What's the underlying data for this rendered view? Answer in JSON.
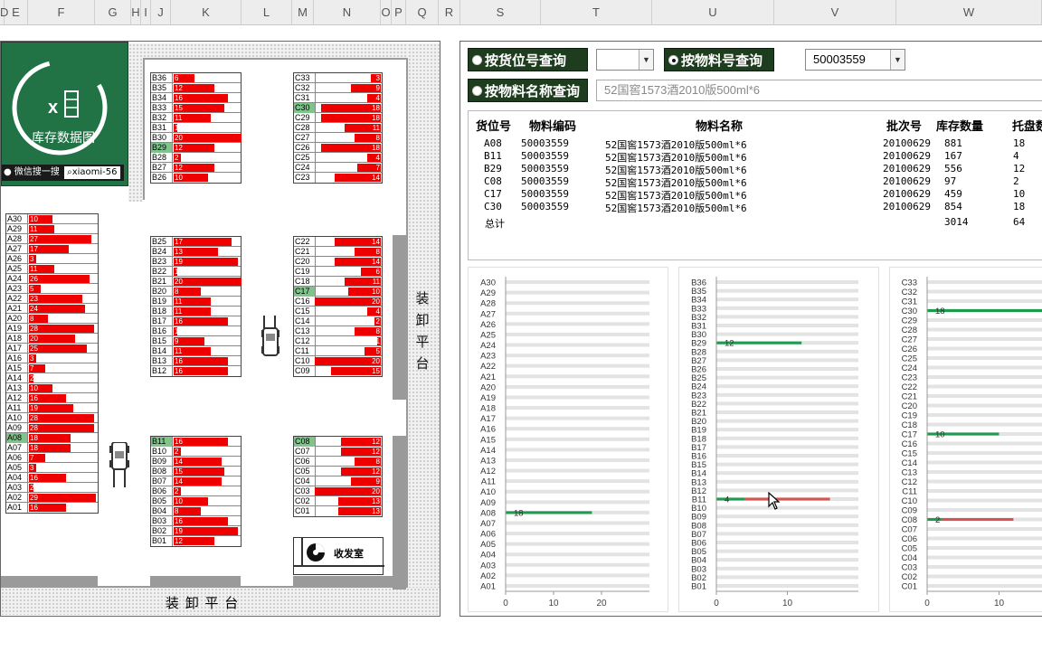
{
  "columns": [
    "D",
    "E",
    "F",
    "G",
    "H",
    "I",
    "J",
    "K",
    "L",
    "M",
    "N",
    "O",
    "P",
    "Q",
    "R",
    "S",
    "T",
    "U",
    "V",
    "W"
  ],
  "logo": {
    "title": "库存数据图",
    "search_text": "微信搜一搜",
    "search_id": "xiaomi-56"
  },
  "map": {
    "dock_right": "装卸平台",
    "dock_bottom": "装 卸 平 台",
    "mail_room": "收发室"
  },
  "racks": {
    "B_top": [
      [
        "B36",
        "6"
      ],
      [
        "B35",
        "12"
      ],
      [
        "B34",
        "16"
      ],
      [
        "B33",
        "15"
      ],
      [
        "B32",
        "11"
      ],
      [
        "B31",
        "1"
      ],
      [
        "B30",
        "20"
      ],
      [
        "B29",
        "12"
      ],
      [
        "B28",
        "2"
      ],
      [
        "B27",
        "12"
      ],
      [
        "B26",
        "10"
      ]
    ],
    "C_top": [
      [
        "C33",
        "3"
      ],
      [
        "C32",
        "9"
      ],
      [
        "C31",
        "4"
      ],
      [
        "C30",
        "18"
      ],
      [
        "C29",
        "18"
      ],
      [
        "C28",
        "11"
      ],
      [
        "C27",
        "8"
      ],
      [
        "C26",
        "18"
      ],
      [
        "C25",
        "4"
      ],
      [
        "C24",
        "7"
      ],
      [
        "C23",
        "14"
      ]
    ],
    "A": [
      [
        "A30",
        "10"
      ],
      [
        "A29",
        "11"
      ],
      [
        "A28",
        "27"
      ],
      [
        "A27",
        "17"
      ],
      [
        "A26",
        "3"
      ],
      [
        "A25",
        "11"
      ],
      [
        "A24",
        "26"
      ],
      [
        "A23",
        "5"
      ],
      [
        "A22",
        "23"
      ],
      [
        "A21",
        "24"
      ],
      [
        "A20",
        "8"
      ],
      [
        "A19",
        "28"
      ],
      [
        "A18",
        "20"
      ],
      [
        "A17",
        "25"
      ],
      [
        "A16",
        "3"
      ],
      [
        "A15",
        "7"
      ],
      [
        "A14",
        "2"
      ],
      [
        "A13",
        "10"
      ],
      [
        "A12",
        "16"
      ],
      [
        "A11",
        "19"
      ],
      [
        "A10",
        "28"
      ],
      [
        "A09",
        "28"
      ],
      [
        "A08",
        "18"
      ],
      [
        "A07",
        "18"
      ],
      [
        "A06",
        "7"
      ],
      [
        "A05",
        "3"
      ],
      [
        "A04",
        "16"
      ],
      [
        "A03",
        "2"
      ],
      [
        "A02",
        "29"
      ],
      [
        "A01",
        "16"
      ]
    ],
    "B_mid": [
      [
        "B25",
        "17"
      ],
      [
        "B24",
        "13"
      ],
      [
        "B23",
        "19"
      ],
      [
        "B22",
        "1"
      ],
      [
        "B21",
        "20"
      ],
      [
        "B20",
        "8"
      ],
      [
        "B19",
        "11"
      ],
      [
        "B18",
        "11"
      ],
      [
        "B17",
        "16"
      ],
      [
        "B16",
        "1"
      ],
      [
        "B15",
        "9"
      ],
      [
        "B14",
        "11"
      ],
      [
        "B13",
        "16"
      ],
      [
        "B12",
        "16"
      ]
    ],
    "C_mid": [
      [
        "C22",
        "14"
      ],
      [
        "C21",
        "8"
      ],
      [
        "C20",
        "14"
      ],
      [
        "C19",
        "6"
      ],
      [
        "C18",
        "11"
      ],
      [
        "C17",
        "10"
      ],
      [
        "C16",
        "20"
      ],
      [
        "C15",
        "4"
      ],
      [
        "C14",
        "2"
      ],
      [
        "C13",
        "8"
      ],
      [
        "C12",
        "1"
      ],
      [
        "C11",
        "5"
      ],
      [
        "C10",
        "20"
      ],
      [
        "C09",
        "15"
      ]
    ],
    "B_bot": [
      [
        "B11",
        "16"
      ],
      [
        "B10",
        "2"
      ],
      [
        "B09",
        "14"
      ],
      [
        "B08",
        "15"
      ],
      [
        "B07",
        "14"
      ],
      [
        "B06",
        "2"
      ],
      [
        "B05",
        "10"
      ],
      [
        "B04",
        "8"
      ],
      [
        "B03",
        "16"
      ],
      [
        "B02",
        "19"
      ],
      [
        "B01",
        "12"
      ]
    ],
    "C_bot": [
      [
        "C08",
        "12"
      ],
      [
        "C07",
        "12"
      ],
      [
        "C06",
        "8"
      ],
      [
        "C05",
        "12"
      ],
      [
        "C04",
        "9"
      ],
      [
        "C03",
        "20"
      ],
      [
        "C02",
        "13"
      ],
      [
        "C01",
        "13"
      ]
    ]
  },
  "highlight": [
    "A08",
    "B11",
    "B29",
    "C08",
    "C17",
    "C30"
  ],
  "query": {
    "by_location": "按货位号查询",
    "by_code": "按物料号查询",
    "by_name": "按物料名称查询",
    "code_value": "50003559",
    "name_value": "52国窖1573酒2010版500ml*6",
    "location_value": ""
  },
  "table": {
    "headers": [
      "货位号",
      "物料编码",
      "物料名称",
      "批次号",
      "库存数量",
      "托盘数"
    ],
    "rows": [
      [
        "A08",
        "50003559",
        "52国窖1573酒2010版500ml*6",
        "20100629",
        "881",
        "18"
      ],
      [
        "B11",
        "50003559",
        "52国窖1573酒2010版500ml*6",
        "20100629",
        "167",
        "4"
      ],
      [
        "B29",
        "50003559",
        "52国窖1573酒2010版500ml*6",
        "20100629",
        "556",
        "12"
      ],
      [
        "C08",
        "50003559",
        "52国窖1573酒2010版500ml*6",
        "20100629",
        "97",
        "2"
      ],
      [
        "C17",
        "50003559",
        "52国窖1573酒2010版500ml*6",
        "20100629",
        "459",
        "10"
      ],
      [
        "C30",
        "50003559",
        "52国窖1573酒2010版500ml*6",
        "20100629",
        "854",
        "18"
      ]
    ],
    "total_label": "总计",
    "total_qty": "3014",
    "total_pallets": "64"
  },
  "colors": {
    "accent_green": "#1e9c4e",
    "bar_red": "#ee0000",
    "excel_green": "#217346"
  },
  "chart_data": [
    {
      "type": "bar",
      "orientation": "horizontal",
      "group": "A",
      "categories": [
        "A30",
        "A29",
        "A28",
        "A27",
        "A26",
        "A25",
        "A24",
        "A23",
        "A22",
        "A21",
        "A20",
        "A19",
        "A18",
        "A17",
        "A16",
        "A15",
        "A14",
        "A13",
        "A12",
        "A11",
        "A10",
        "A09",
        "A08",
        "A07",
        "A06",
        "A05",
        "A04",
        "A03",
        "A02",
        "A01"
      ],
      "values": [
        {
          "cat": "A08",
          "value": 18,
          "label": "18"
        }
      ],
      "xlim": [
        0,
        30
      ],
      "xticks": [
        0,
        10,
        20,
        30
      ],
      "grid": false
    },
    {
      "type": "bar",
      "orientation": "horizontal",
      "group": "B",
      "categories": [
        "B36",
        "B35",
        "B34",
        "B33",
        "B32",
        "B31",
        "B30",
        "B29",
        "B28",
        "B27",
        "B26",
        "B25",
        "B24",
        "B23",
        "B22",
        "B21",
        "B20",
        "B19",
        "B18",
        "B17",
        "B16",
        "B15",
        "B14",
        "B13",
        "B12",
        "B11",
        "B10",
        "B09",
        "B08",
        "B07",
        "B06",
        "B05",
        "B04",
        "B03",
        "B02",
        "B01"
      ],
      "values": [
        {
          "cat": "B29",
          "value": 12,
          "label": "12"
        },
        {
          "cat": "B11",
          "value": 4,
          "label": "4",
          "extra": 16
        }
      ],
      "xlim": [
        0,
        20
      ],
      "xticks": [
        0,
        10,
        20
      ],
      "grid": false
    },
    {
      "type": "bar",
      "orientation": "horizontal",
      "group": "C",
      "categories": [
        "C33",
        "C32",
        "C31",
        "C30",
        "C29",
        "C28",
        "C27",
        "C26",
        "C25",
        "C24",
        "C23",
        "C22",
        "C21",
        "C20",
        "C19",
        "C18",
        "C17",
        "C16",
        "C15",
        "C14",
        "C13",
        "C12",
        "C11",
        "C10",
        "C09",
        "C08",
        "C07",
        "C06",
        "C05",
        "C04",
        "C03",
        "C02",
        "C01"
      ],
      "values": [
        {
          "cat": "C30",
          "value": 18,
          "label": "18"
        },
        {
          "cat": "C17",
          "value": 10,
          "label": "10"
        },
        {
          "cat": "C08",
          "value": 2,
          "label": "2",
          "extra": 12
        }
      ],
      "xlim": [
        0,
        20
      ],
      "xticks": [
        0,
        10
      ],
      "grid": false
    }
  ]
}
